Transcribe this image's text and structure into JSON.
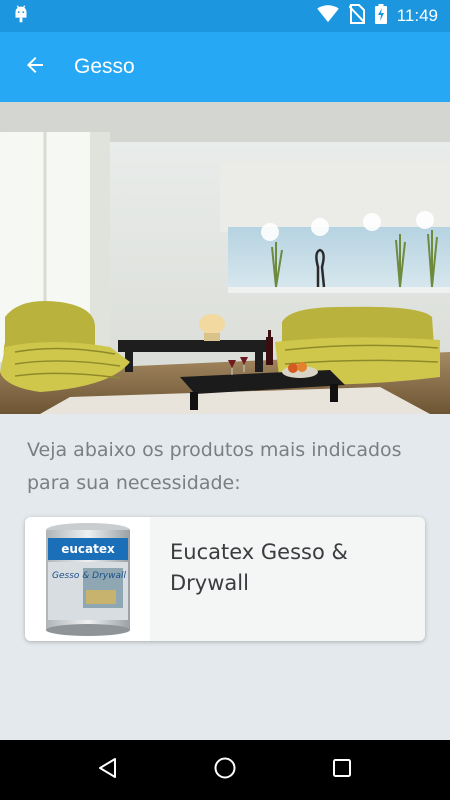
{
  "status_bar": {
    "time": "11:49",
    "icons": [
      "android-debug-icon",
      "wifi-icon",
      "no-sim-icon",
      "battery-charging-icon"
    ]
  },
  "app_bar": {
    "title": "Gesso",
    "back_icon": "arrow-back-icon"
  },
  "hero": {
    "description": "living-room-photo"
  },
  "content": {
    "intro": "Veja abaixo os produtos mais indicados para sua necessidade:"
  },
  "products": [
    {
      "name": "Eucatex Gesso & Drywall",
      "label_brand": "eucatex",
      "label_product": "Gesso & Drywall"
    }
  ],
  "nav_bar": {
    "icons": [
      "back-triangle-icon",
      "home-circle-icon",
      "recents-square-icon"
    ]
  },
  "colors": {
    "status_bar": "#1c97df",
    "app_bar": "#27a8f4",
    "background": "#e3e9ec"
  }
}
